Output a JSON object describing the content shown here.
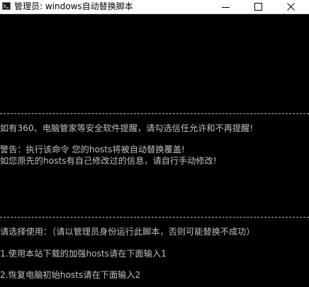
{
  "window": {
    "title": "管理员:  windows自动替换脚本",
    "controls": {
      "minimize_icon": "minimize-icon",
      "maximize_icon": "maximize-icon",
      "close_icon": "close-icon"
    }
  },
  "console": {
    "lines": [
      "如有360、电脑管家等安全软件提醒，请勾选信任允许和不再提醒!",
      "警告：执行该命令 您的hosts将被自动替换覆盖!",
      "如您原先的hosts有自己修改过的信息，请自行手动修改!",
      "请选择使用：（请以管理员身份运行此脚本，否则可能替换不成功）",
      " 1.使用本站下载的加强hosts请在下面输入1",
      " 2.恢复电脑初始hosts请在下面输入2"
    ]
  },
  "colors": {
    "console_bg": "#000000",
    "console_text": "#c0c0c0",
    "titlebar_bg": "#ffffff"
  }
}
